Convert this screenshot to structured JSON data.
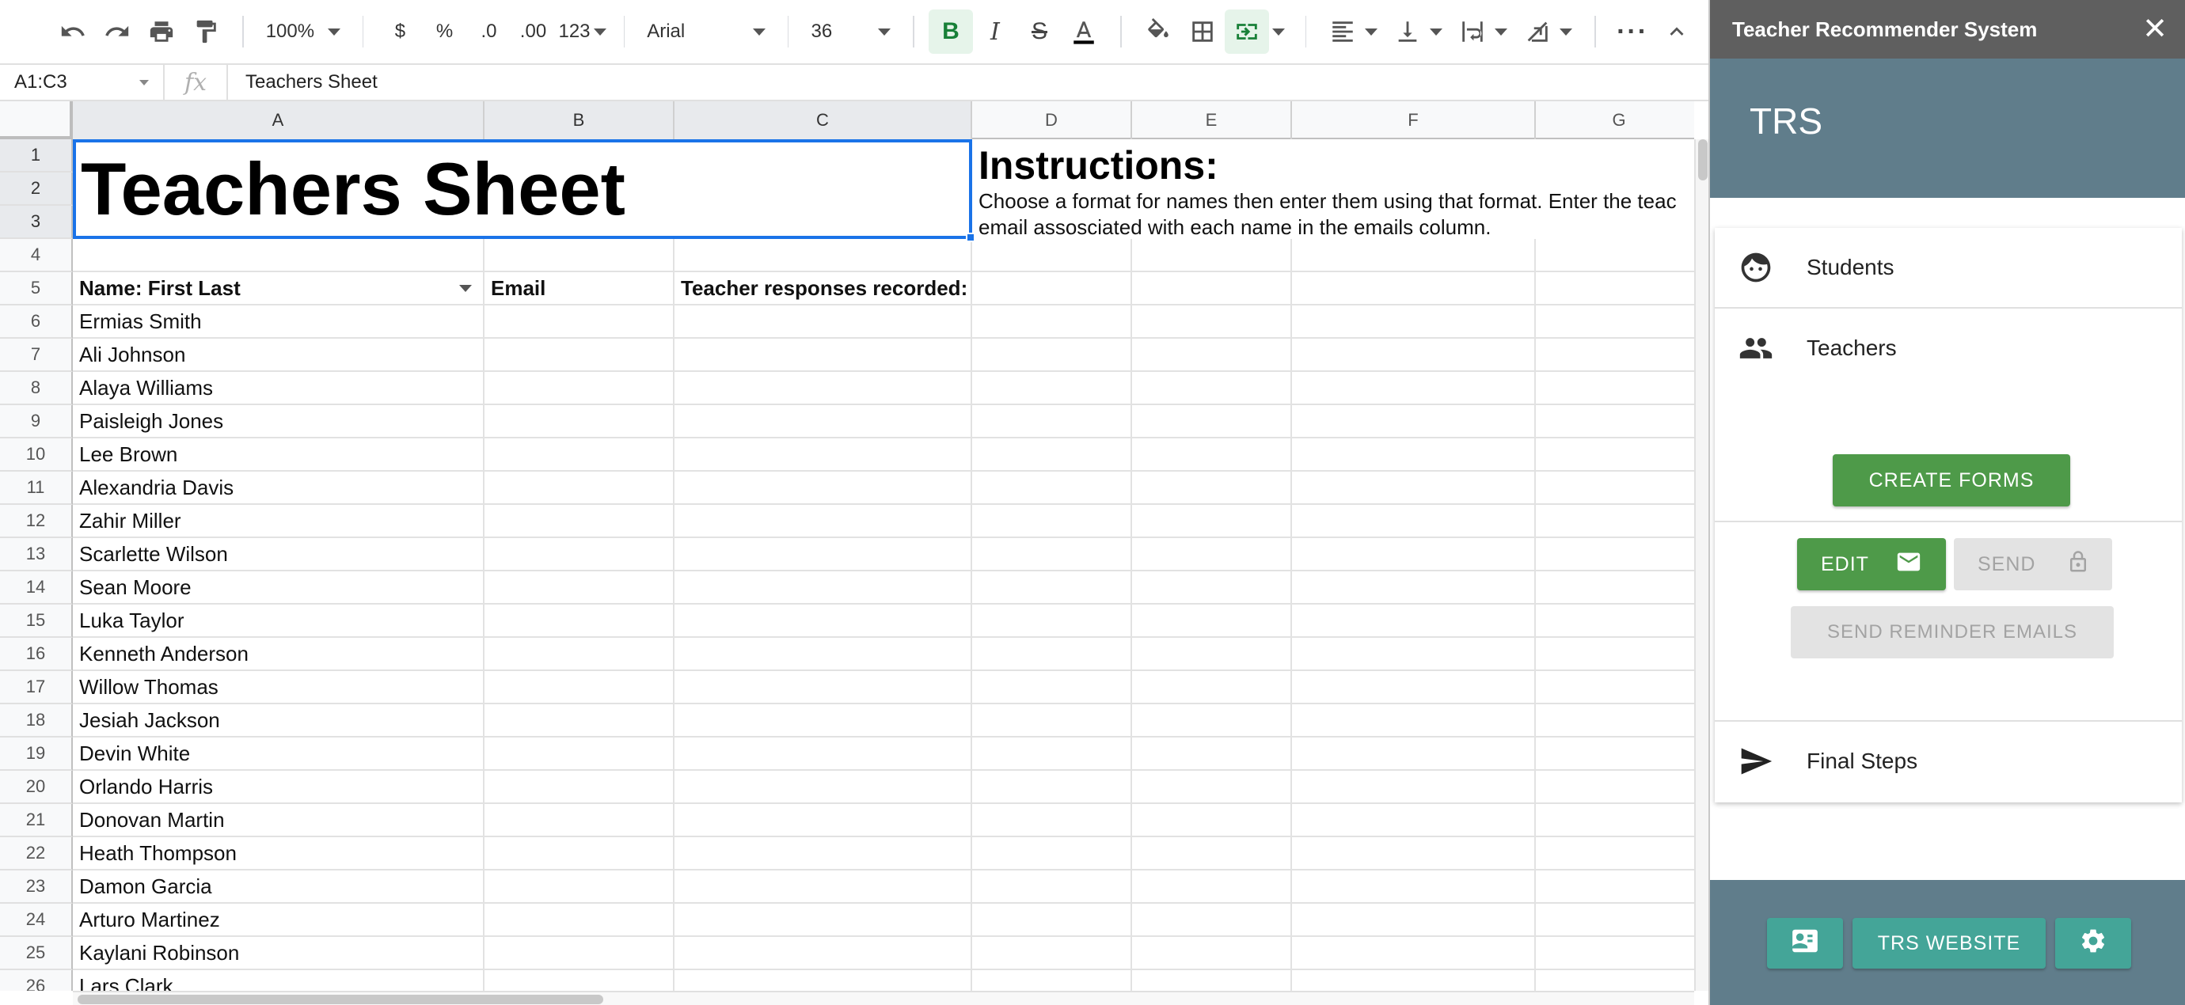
{
  "toolbar": {
    "zoom": "100%",
    "currency": "$",
    "percent": "%",
    "decrease_decimal": ".0",
    "increase_decimal": ".00",
    "number_format": "123",
    "font": "Arial",
    "font_size": "36",
    "colors": {
      "active_bg": "#e6f4ea",
      "active_fg": "#188038",
      "text_color_bar": "#000000"
    }
  },
  "formula_bar": {
    "name_box": "A1:C3",
    "fx": "fx",
    "value": "Teachers Sheet"
  },
  "sheet": {
    "columns": [
      "A",
      "B",
      "C",
      "D",
      "E",
      "F",
      "G"
    ],
    "title": "Teachers Sheet",
    "instructions_title": "Instructions:",
    "instructions_line1": "Choose a format for names then enter them using that format. Enter the teac",
    "instructions_line2": "email assosciated with each name in the emails column.",
    "headers": {
      "name": "Name: First Last",
      "email": "Email",
      "responses": "Teacher responses recorded:"
    },
    "row_numbers": [
      "1",
      "2",
      "3",
      "4",
      "5",
      "6",
      "7",
      "8",
      "9",
      "10",
      "11",
      "12",
      "13",
      "14",
      "15",
      "16",
      "17",
      "18",
      "19",
      "20",
      "21",
      "22",
      "23",
      "24",
      "25",
      "26"
    ],
    "names": [
      "Ermias Smith",
      "Ali Johnson",
      "Alaya Williams",
      "Paisleigh Jones",
      "Lee Brown",
      "Alexandria Davis",
      "Zahir Miller",
      "Scarlette Wilson",
      "Sean Moore",
      "Luka Taylor",
      "Kenneth Anderson",
      "Willow Thomas",
      "Jesiah Jackson",
      "Devin White",
      "Orlando Harris",
      "Donovan Martin",
      "Heath Thompson",
      "Damon Garcia",
      "Arturo Martinez",
      "Kaylani Robinson",
      "Lars Clark"
    ]
  },
  "sidebar": {
    "window_title": "Teacher Recommender System",
    "close": "✕",
    "header": "TRS",
    "nav": {
      "students": "Students",
      "teachers": "Teachers",
      "final_steps": "Final Steps"
    },
    "buttons": {
      "create_forms": "CREATE FORMS",
      "edit": "EDIT",
      "send": "SEND",
      "send_reminder": "SEND REMINDER EMAILS",
      "website": "TRS WEBSITE"
    },
    "colors": {
      "header": "#607d8b",
      "titlebar": "#5f5f5f",
      "green": "#4e9a49",
      "teal": "#44a598"
    }
  }
}
